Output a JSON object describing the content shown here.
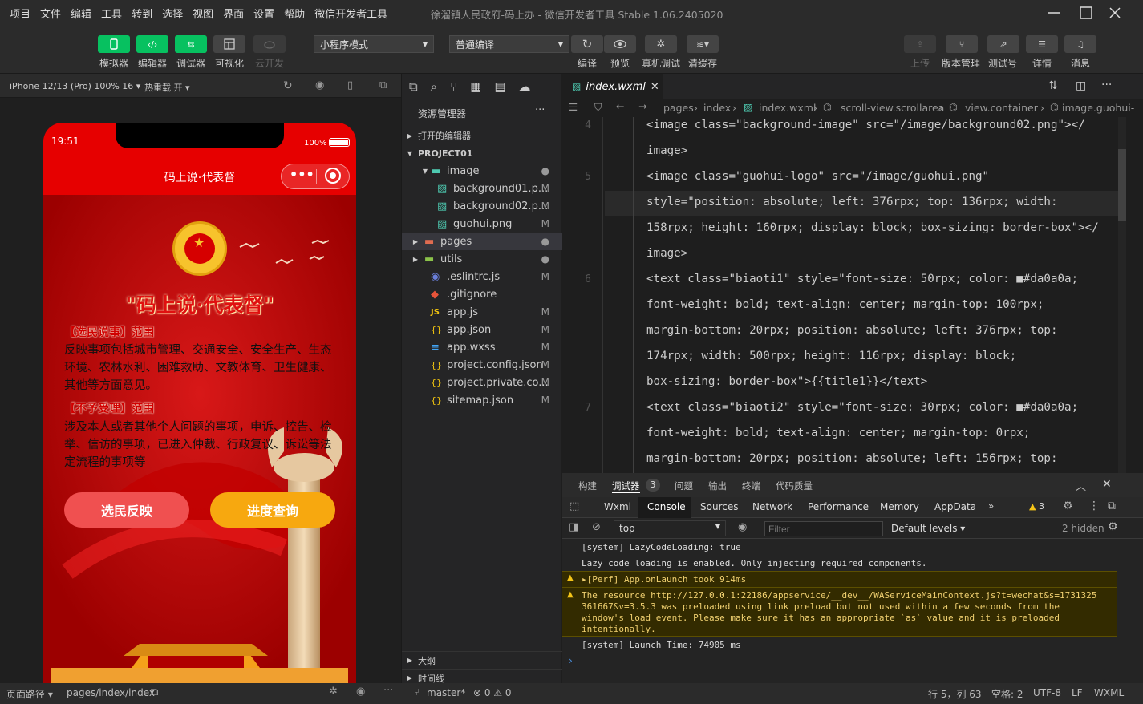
{
  "menu": [
    "项目",
    "文件",
    "编辑",
    "工具",
    "转到",
    "选择",
    "视图",
    "界面",
    "设置",
    "帮助",
    "微信开发者工具"
  ],
  "window_title": "徐溜镇人民政府-码上办 - 微信开发者工具 Stable 1.06.2405020",
  "toolbar": {
    "left_buttons": [
      "模拟器",
      "编辑器",
      "调试器",
      "可视化",
      "云开发"
    ],
    "mode_select": "小程序模式",
    "compile_select": "普通编译",
    "mid_buttons": [
      "编译",
      "预览",
      "真机调试",
      "清缓存"
    ],
    "right_buttons": [
      "上传",
      "版本管理",
      "测试号",
      "详情",
      "消息"
    ]
  },
  "simulator": {
    "device": "iPhone 12/13 (Pro) 100% 16 ▾",
    "hotreload": "热重载 开 ▾",
    "time": "19:51",
    "battery": "100%",
    "nav_title": "码上说·代表督",
    "headline": "\"码上说·代表督\"",
    "section1_title": "【选民说事】范围",
    "section1_body": "反映事项包括城市管理、交通安全、安全生产、生态环境、农林水利、困难救助、文教体育、卫生健康、其他等方面意见。",
    "section2_title": "【不予受理】范围",
    "section2_body": "涉及本人或者其他个人问题的事项，申诉、控告、检举、信访的事项，已进入仲裁、行政复议、诉讼等法定流程的事项等",
    "btn_left": "选民反映",
    "btn_right": "进度查询"
  },
  "explorer": {
    "title": "资源管理器",
    "open_editors": "打开的编辑器",
    "project": "PROJECT01",
    "items": [
      {
        "name": "image",
        "status": "●",
        "type": "folder-open"
      },
      {
        "name": "background01.p...",
        "status": "M",
        "type": "img"
      },
      {
        "name": "background02.p...",
        "status": "M",
        "type": "img"
      },
      {
        "name": "guohui.png",
        "status": "M",
        "type": "img"
      },
      {
        "name": "pages",
        "status": "●",
        "type": "folder"
      },
      {
        "name": "utils",
        "status": "●",
        "type": "folder"
      },
      {
        "name": ".eslintrc.js",
        "status": "M",
        "type": "eslint"
      },
      {
        "name": ".gitignore",
        "status": "",
        "type": "git"
      },
      {
        "name": "app.js",
        "status": "M",
        "type": "js"
      },
      {
        "name": "app.json",
        "status": "M",
        "type": "json"
      },
      {
        "name": "app.wxss",
        "status": "M",
        "type": "css"
      },
      {
        "name": "project.config.json",
        "status": "M",
        "type": "json"
      },
      {
        "name": "project.private.co...",
        "status": "M",
        "type": "json"
      },
      {
        "name": "sitemap.json",
        "status": "M",
        "type": "json"
      }
    ],
    "outline": "大纲",
    "timeline": "时间线"
  },
  "editor": {
    "tab": "index.wxml",
    "breadcrumb": [
      "pages",
      "index",
      "index.wxml",
      "scroll-view.scrollarea",
      "view.container",
      "image.guohui-"
    ],
    "lines": [
      {
        "n": "4",
        "text": "<image class=\"background-image\" src=\"/image/background02.png\"></"
      },
      {
        "n": "",
        "text": "image>"
      },
      {
        "n": "5",
        "text": "<image class=\"guohui-logo\" src=\"/image/guohui.png\""
      },
      {
        "n": "",
        "text": "style=\"position: absolute; left: 376rpx; top: 136rpx; width:"
      },
      {
        "n": "",
        "text": "158rpx; height: 160rpx; display: block; box-sizing: border-box\"></"
      },
      {
        "n": "",
        "text": "image>"
      },
      {
        "n": "6",
        "text": "<text class=\"biaoti1\" style=\"font-size: 50rpx; color: ■#da0a0a;"
      },
      {
        "n": "",
        "text": "font-weight: bold; text-align: center; margin-top: 100rpx;"
      },
      {
        "n": "",
        "text": "margin-bottom: 20rpx; position: absolute; left: 376rpx; top:"
      },
      {
        "n": "",
        "text": "174rpx; width: 500rpx; height: 116rpx; display: block;"
      },
      {
        "n": "",
        "text": "box-sizing: border-box\">{{title1}}</text>"
      },
      {
        "n": "7",
        "text": "<text class=\"biaoti2\" style=\"font-size: 30rpx; color: ■#da0a0a;"
      },
      {
        "n": "",
        "text": "font-weight: bold; text-align: center; margin-top: 0rpx;"
      },
      {
        "n": "",
        "text": "margin-bottom: 20rpx; position: absolute; left: 156rpx; top:"
      }
    ]
  },
  "devtools": {
    "panel_tabs": [
      "构建",
      "调试器",
      "问题",
      "输出",
      "终端",
      "代码质量"
    ],
    "debugger_count": "3",
    "sub_tabs": [
      "Wxml",
      "Console",
      "Sources",
      "Network",
      "Performance",
      "Memory",
      "AppData"
    ],
    "warn_count": "3",
    "context": "top",
    "filter_placeholder": "Filter",
    "levels": "Default levels ▾",
    "hidden": "2 hidden",
    "logs": [
      "[system] LazyCodeLoading: true",
      "Lazy code loading is enabled. Only injecting required components.",
      "▸[Perf] App.onLaunch took 914ms",
      "The resource http://127.0.0.1:22186/appservice/__dev__/WAServiceMainContext.js?t=wechat&s=1731325",
      "361667&v=3.5.3 was preloaded using link preload but not used within a few seconds from the",
      "window's load event. Please make sure it has an appropriate `as` value and it is preloaded",
      "intentionally.",
      "[system] Launch Time: 74905 ms"
    ]
  },
  "status": {
    "page_path_label": "页面路径 ▾",
    "page_path": "pages/index/index",
    "branch": "master*",
    "problems": "⊗ 0 ⚠ 0",
    "cursor": "行 5，列 63",
    "spaces": "空格: 2",
    "encoding": "UTF-8",
    "eol": "LF",
    "lang": "WXML"
  }
}
